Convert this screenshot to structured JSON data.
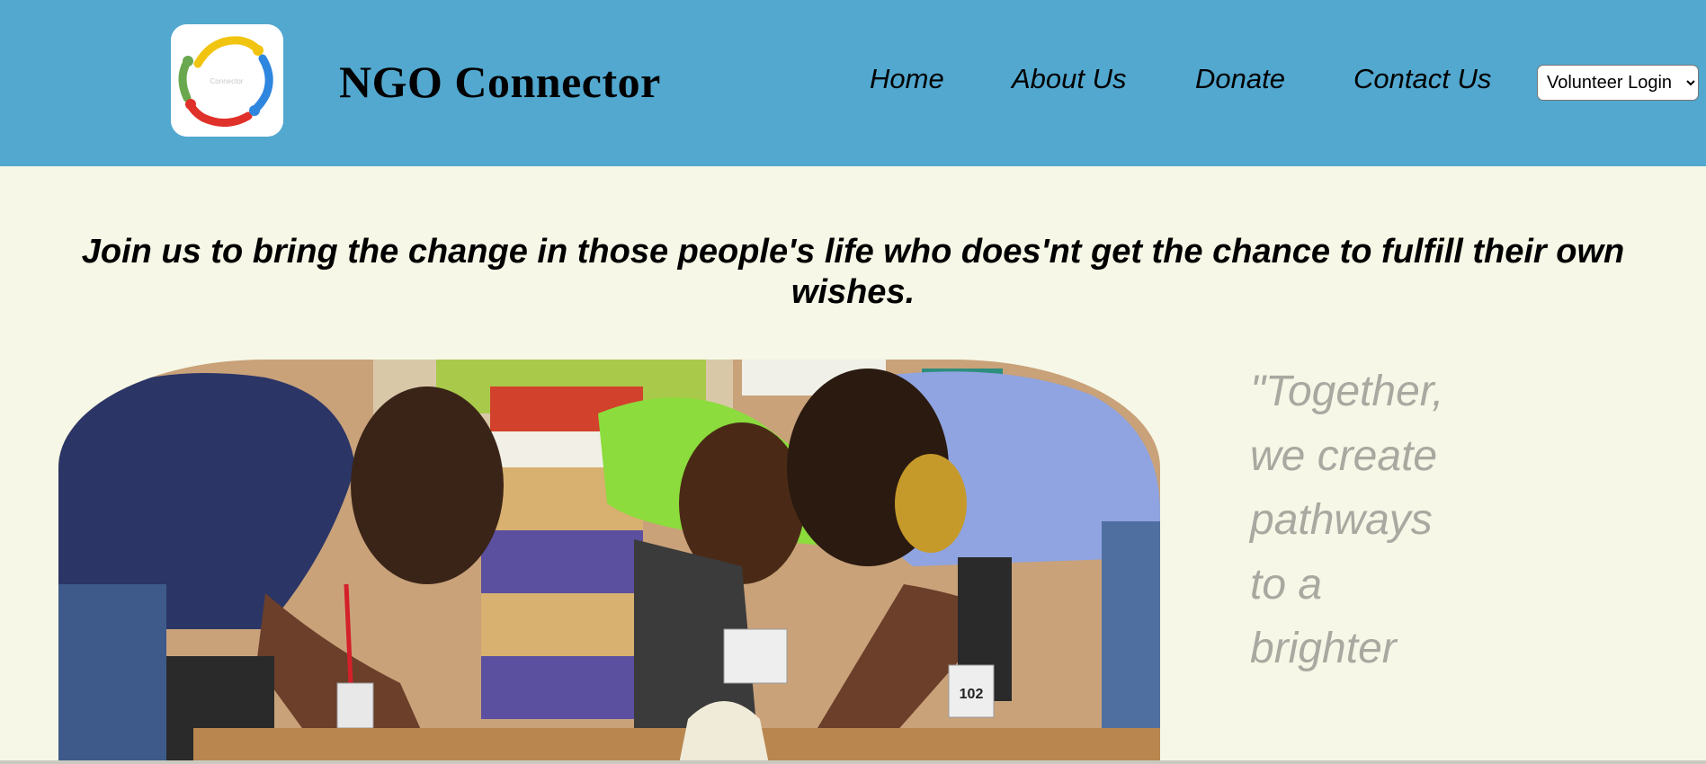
{
  "header": {
    "brand_title": "NGO Connector",
    "logo_text": "Connector",
    "nav": [
      {
        "label": "Home"
      },
      {
        "label": "About Us"
      },
      {
        "label": "Donate"
      },
      {
        "label": "Contact Us"
      }
    ],
    "login_select": {
      "selected": "Volunteer Login"
    }
  },
  "main": {
    "headline": "Join us to bring the change in those people's life who does'nt get the chance to fulfill their own wishes.",
    "photo_badge": "102",
    "quote": "\"Together, we create pathways to a brighter"
  },
  "colors": {
    "header_bg": "#52a8cf",
    "page_bg": "#f6f7e6",
    "quote_text": "#a9a9a1"
  }
}
